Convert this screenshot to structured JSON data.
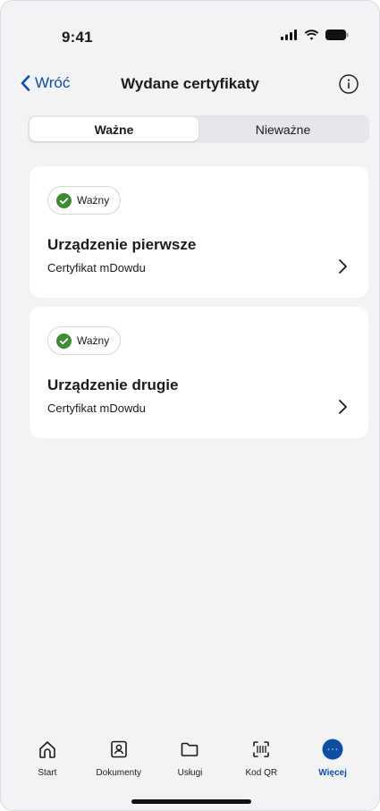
{
  "status_bar": {
    "time": "9:41"
  },
  "nav": {
    "back_label": "Wróć",
    "title": "Wydane certyfikaty"
  },
  "segments": [
    {
      "label": "Ważne",
      "active": true
    },
    {
      "label": "Nieważne",
      "active": false
    }
  ],
  "cards": [
    {
      "badge": "Ważny",
      "title": "Urządzenie pierwsze",
      "subtitle": "Certyfikat mDowdu"
    },
    {
      "badge": "Ważny",
      "title": "Urządzenie drugie",
      "subtitle": "Certyfikat mDowdu"
    }
  ],
  "tabs": [
    {
      "label": "Start",
      "icon": "home-icon"
    },
    {
      "label": "Dokumenty",
      "icon": "id-card-icon"
    },
    {
      "label": "Usługi",
      "icon": "folder-icon"
    },
    {
      "label": "Kod QR",
      "icon": "qr-scan-icon"
    },
    {
      "label": "Więcej",
      "icon": "more-icon",
      "active": true
    }
  ],
  "colors": {
    "accent": "#0b4ea2",
    "valid_green": "#3f8a34",
    "background": "#f2f3f5",
    "card": "#ffffff"
  }
}
